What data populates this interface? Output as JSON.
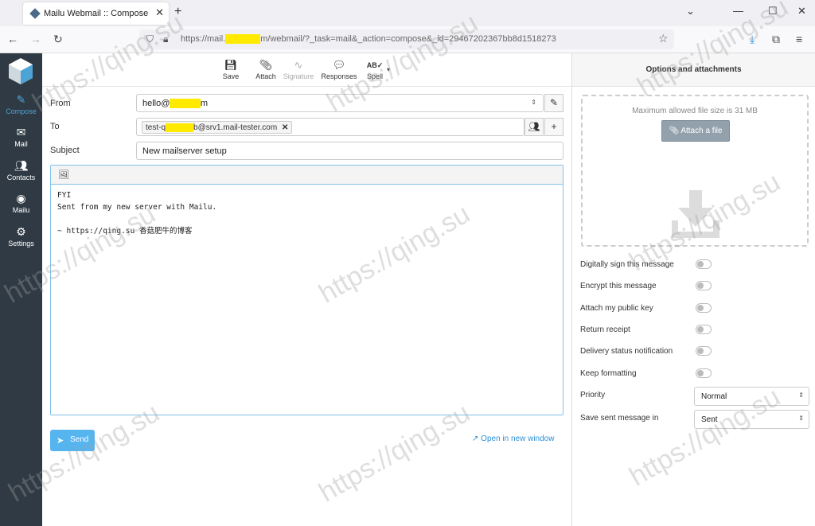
{
  "browser": {
    "tab_title": "Mailu Webmail :: Compose",
    "url_prefix": "https://mail.",
    "url_redacted": "xxxxxxxx",
    "url_suffix": "m/webmail/?_task=mail&_action=compose&_id=29467202367bb8d1518273"
  },
  "sidebar": {
    "items": [
      {
        "label": "Compose",
        "icon": "compose-icon"
      },
      {
        "label": "Mail",
        "icon": "envelope-icon"
      },
      {
        "label": "Contacts",
        "icon": "contacts-icon"
      },
      {
        "label": "Mailu",
        "icon": "mailu-icon"
      },
      {
        "label": "Settings",
        "icon": "gear-icon"
      }
    ]
  },
  "toolbar": {
    "save": "Save",
    "attach": "Attach",
    "signature": "Signature",
    "responses": "Responses",
    "spell": "Spell"
  },
  "form": {
    "from_label": "From",
    "from_prefix": "hello@",
    "from_redacted": "xxxxxxx",
    "from_suffix": "m",
    "to_label": "To",
    "to_prefix": "test-q",
    "to_redacted": "xxxxxxx",
    "to_suffix": "b@srv1.mail-tester.com",
    "subject_label": "Subject",
    "subject_value": "New mailserver setup"
  },
  "editor": {
    "body": "FYI\nSent from my new server with Mailu.\n\n~ https://qing.su 香菇肥牛的博客"
  },
  "actions": {
    "send": "Send",
    "open_new_window": "Open in new window"
  },
  "options": {
    "header": "Options and attachments",
    "max_size": "Maximum allowed file size is 31 MB",
    "attach_file": "Attach a file",
    "toggles": [
      "Digitally sign this message",
      "Encrypt this message",
      "Attach my public key",
      "Return receipt",
      "Delivery status notification",
      "Keep formatting"
    ],
    "priority_label": "Priority",
    "priority_value": "Normal",
    "save_sent_label": "Save sent message in",
    "save_sent_value": "Sent"
  },
  "watermark": "https://qing.su",
  "colors": {
    "sidebar_bg": "#2f3a44",
    "accent": "#4ea3d6",
    "send_button": "#56b4ef"
  }
}
